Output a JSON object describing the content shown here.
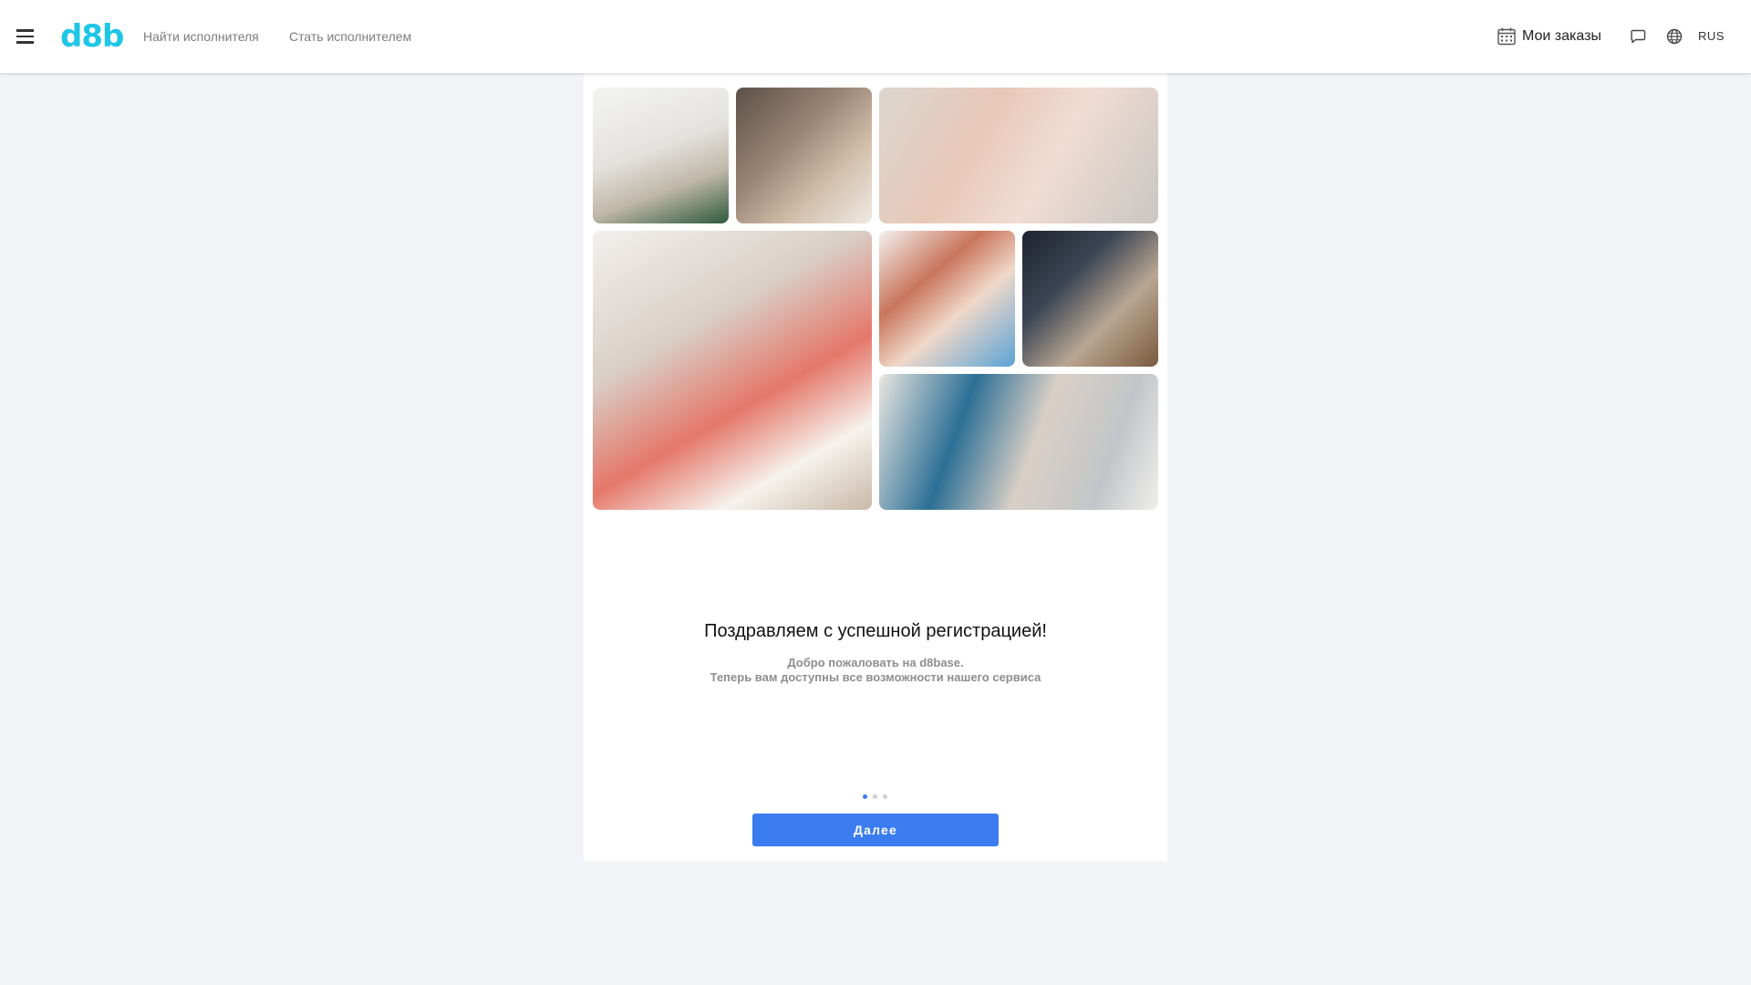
{
  "header": {
    "menu_icon": "hamburger-menu-icon",
    "logo_text": "d8b",
    "nav": {
      "find_performer": "Найти исполнителя",
      "become_performer": "Стать исполнителем"
    },
    "orders": {
      "icon": "calendar-icon",
      "label": "Мои заказы"
    },
    "chat_icon": "chat-bubble-icon",
    "language_icon": "globe-icon",
    "language": "RUS"
  },
  "onboarding": {
    "photos": [
      "plumber-photo",
      "pottery-class-photo",
      "tutoring-photo",
      "painter-and-model-photo",
      "photographer-photo",
      "hairdresser-photo",
      "doctor-patient-photo"
    ],
    "title": "Поздравляем с успешной регистрацией!",
    "subtitle_line1": "Добро пожаловать на d8base.",
    "subtitle_line2": "Теперь вам доступны все возможности нашего сервиса",
    "pagination": {
      "total": 3,
      "current": 1
    },
    "next_button": "Далее"
  },
  "colors": {
    "brand": "#1ec6e6",
    "primary_button": "#3b7df0",
    "page_background": "#f3f4f8"
  }
}
